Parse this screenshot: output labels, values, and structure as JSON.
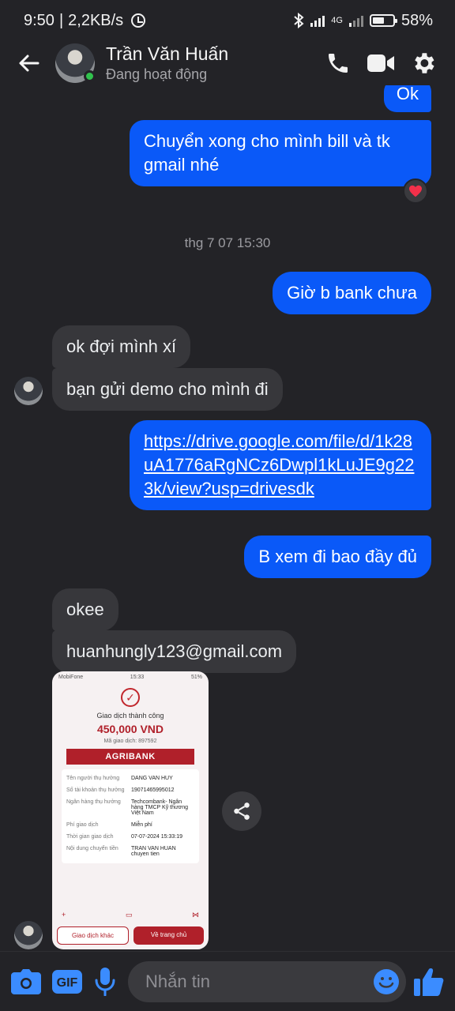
{
  "status_bar": {
    "time": "9:50",
    "speed": "2,2KB/s",
    "network": "4G",
    "battery": "58%",
    "battery_level": 0.58
  },
  "header": {
    "name": "Trần Văn Huấn",
    "status": "Đang hoạt động"
  },
  "messages": {
    "ok": "Ok",
    "bill": "Chuyển xong cho mình bill và tk gmail nhé",
    "timestamp": "thg 7 07 15:30",
    "bank": "Giờ b bank chưa",
    "wait": "ok đợi mình xí",
    "demo": "bạn gửi demo cho mình đi",
    "link": "https://drive.google.com/file/d/1k28uA1776aRgNCz6Dwpl1kLuJE9g223k/view?usp=drivesdk",
    "see": "B xem đi bao đầy đủ",
    "okee": "okee",
    "email": "huanhungly123@gmail.com"
  },
  "receipt": {
    "carrier": "MobiFone",
    "time": "15:33",
    "battery": "51%",
    "title": "Giao dịch thành công",
    "amount": "450,000 VND",
    "code": "Mã giao dịch: 897592",
    "bank": "AGRIBANK",
    "rows": [
      {
        "k": "Tên người thụ hưởng",
        "v": "DANG VAN HUY"
      },
      {
        "k": "Số tài khoản thụ hưởng",
        "v": "19071465995012"
      },
      {
        "k": "Ngân hàng thụ hưởng",
        "v": "Techcombank- Ngân hàng TMCP Kỹ thương Việt Nam"
      },
      {
        "k": "Phí giao dịch",
        "v": "Miễn phí"
      },
      {
        "k": "Thời gian giao dịch",
        "v": "07-07-2024 15:33:19"
      },
      {
        "k": "Nội dung chuyển tiền",
        "v": "TRAN VAN HUAN chuyen tien"
      }
    ],
    "btn_other": "Giao dịch khác",
    "btn_home": "Về trang chủ"
  },
  "composer": {
    "placeholder": "Nhắn tin",
    "gif_label": "GIF"
  },
  "colors": {
    "accent": "#0a59f8",
    "bubble_them": "#37373b",
    "background": "#232327",
    "online": "#31c24d",
    "agribank": "#b0202a"
  },
  "icons": [
    "back-arrow-icon",
    "phone-icon",
    "video-icon",
    "gear-icon",
    "heart-icon",
    "share-icon",
    "camera-icon",
    "gif-icon",
    "mic-icon",
    "emoji-icon",
    "thumbs-up-icon"
  ]
}
